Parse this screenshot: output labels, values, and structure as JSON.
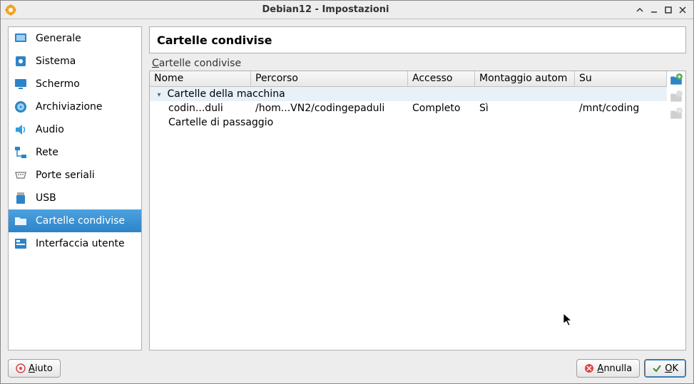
{
  "titlebar": {
    "title": "Debian12 - Impostazioni"
  },
  "sidebar": {
    "items": [
      {
        "label": "Generale"
      },
      {
        "label": "Sistema"
      },
      {
        "label": "Schermo"
      },
      {
        "label": "Archiviazione"
      },
      {
        "label": "Audio"
      },
      {
        "label": "Rete"
      },
      {
        "label": "Porte seriali"
      },
      {
        "label": "USB"
      },
      {
        "label": "Cartelle condivise"
      },
      {
        "label": "Interfaccia utente"
      }
    ]
  },
  "main": {
    "heading": "Cartelle condivise",
    "group_label_prefix": "C",
    "group_label_rest": "artelle condivise",
    "columns": {
      "name": "Nome",
      "path": "Percorso",
      "access": "Accesso",
      "automount": "Montaggio autom",
      "at": "Su"
    },
    "group_machine": "Cartelle della macchina",
    "group_transient": "Cartelle di passaggio",
    "rows": [
      {
        "name": "codin...duli",
        "path": "/hom...VN2/codingepaduli",
        "access": "Completo",
        "automount": "Sì",
        "at": "/mnt/coding"
      }
    ]
  },
  "footer": {
    "help_prefix": "A",
    "help_rest": "iuto",
    "cancel_prefix": "A",
    "cancel_rest": "nnulla",
    "ok_prefix": "O",
    "ok_rest": "K"
  }
}
